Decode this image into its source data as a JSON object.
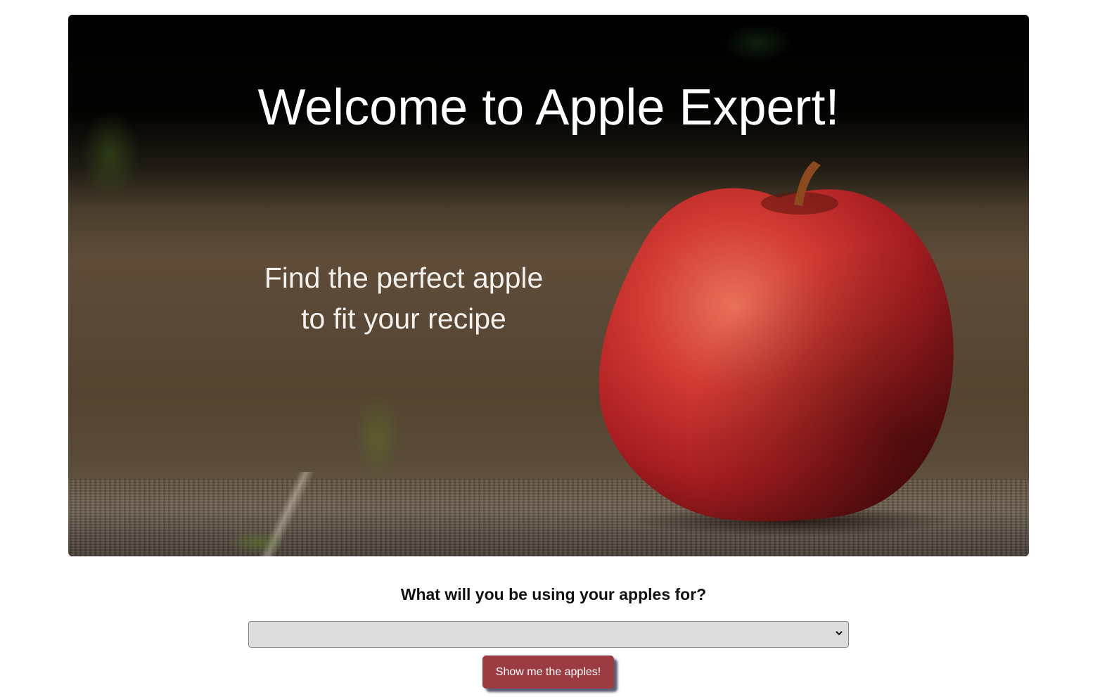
{
  "hero": {
    "title": "Welcome to Apple Expert!",
    "subtitle_line1": "Find the perfect apple",
    "subtitle_line2": "to fit your recipe"
  },
  "form": {
    "question": "What will you be using your apples for?",
    "select_value": "",
    "button_label": "Show me the apples!"
  },
  "icons": {
    "select_chevron": "chevron-down-icon"
  },
  "colors": {
    "button_background": "#9b3c42",
    "select_background": "#dcdcdc",
    "apple_red": "#c7232a"
  }
}
